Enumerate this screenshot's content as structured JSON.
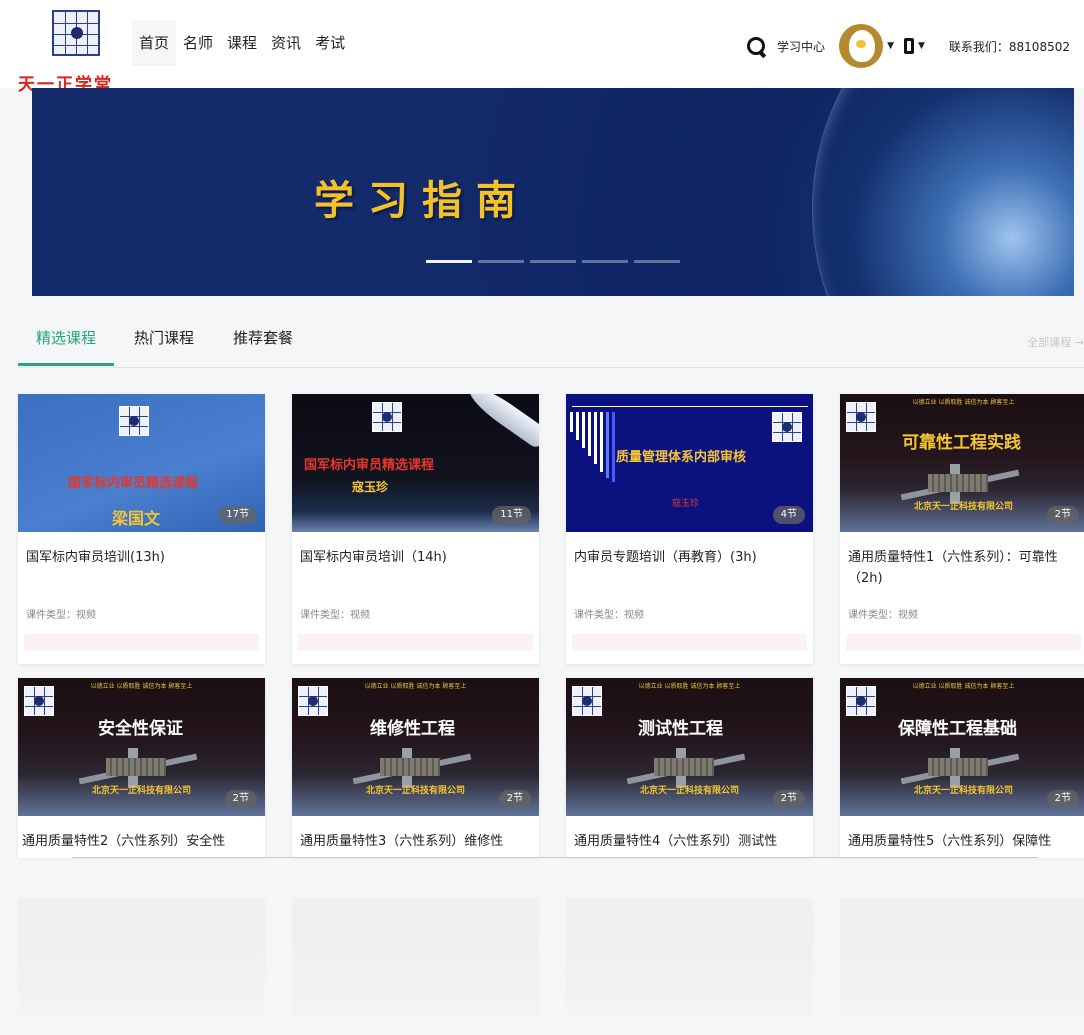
{
  "header": {
    "logo_text": "天一正学堂",
    "nav": [
      {
        "label": "首页",
        "active": true
      },
      {
        "label": "名师",
        "active": false
      },
      {
        "label": "课程",
        "active": false
      },
      {
        "label": "资讯",
        "active": false
      },
      {
        "label": "考试",
        "active": false
      }
    ],
    "study_center": "学习中心",
    "contact": "联系我们：88108502"
  },
  "banner": {
    "title": "学习指南",
    "slide_count": 5,
    "active_slide": 1
  },
  "tabs": {
    "items": [
      "精选课程",
      "热门课程",
      "推荐套餐"
    ],
    "active": "精选课程",
    "all_link": "全部课程 →"
  },
  "courses": [
    {
      "title": "国军标内审员培训(13h)",
      "type": "课件类型：视频",
      "count": "17节",
      "thumb": {
        "style": "blue",
        "lines": [
          "国军标内审员精选课程",
          "梁国文"
        ]
      }
    },
    {
      "title": "国军标内审员培训（14h)",
      "type": "课件类型：视频",
      "count": "11节",
      "thumb": {
        "style": "space",
        "lines": [
          "国军标内审员精选课程",
          "寇玉珍"
        ]
      }
    },
    {
      "title": "内审员专题培训（再教育）(3h)",
      "type": "课件类型：视频",
      "count": "4节",
      "thumb": {
        "style": "navy",
        "lines": [
          "质量管理体系内部审核",
          "寇玉珍"
        ]
      }
    },
    {
      "title": "通用质量特性1（六性系列）：可靠性（2h)",
      "type": "课件类型：视频",
      "count": "2节",
      "thumb": {
        "style": "station",
        "lines": [
          "可靠性工程实践"
        ],
        "slogan": "以德立业 以质取胜 诚信为本 顾客至上",
        "company": "北京天一正科技有限公司"
      }
    },
    {
      "title": "通用质量特性2（六性系列）安全性",
      "count": "2节",
      "thumb": {
        "style": "station",
        "lines": [
          "安全性保证"
        ],
        "slogan": "以德立业 以质取胜 诚信为本 顾客至上",
        "company": "北京天一正科技有限公司"
      }
    },
    {
      "title": "通用质量特性3（六性系列）维修性",
      "count": "2节",
      "thumb": {
        "style": "station",
        "lines": [
          "维修性工程"
        ],
        "slogan": "以德立业 以质取胜 诚信为本 顾客至上",
        "company": "北京天一正科技有限公司"
      }
    },
    {
      "title": "通用质量特性4（六性系列）测试性",
      "count": "2节",
      "thumb": {
        "style": "station",
        "lines": [
          "测试性工程"
        ],
        "slogan": "以德立业 以质取胜 诚信为本 顾客至上",
        "company": "北京天一正科技有限公司"
      }
    },
    {
      "title": "通用质量特性5（六性系列）保障性",
      "count": "2节",
      "thumb": {
        "style": "station",
        "lines": [
          "保障性工程基础"
        ],
        "slogan": "以德立业 以质取胜 诚信为本 顾客至上",
        "company": "北京天一正科技有限公司"
      }
    }
  ],
  "colors": {
    "accent": "#24a676",
    "banner_title": "#f6c02a",
    "logo_red": "#d5261f"
  }
}
